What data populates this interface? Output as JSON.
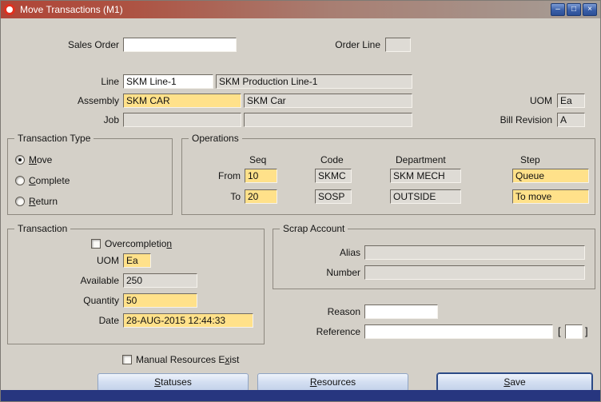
{
  "colors": {
    "titlebar_red": "#b04537",
    "canvas_gray": "#d4d0c8",
    "required_field_yellow": "#ffe18a",
    "readonly_field_gray": "#dedbd5",
    "button_face_blue": "#d5e0f2",
    "bottom_bar_navy": "#27367f"
  },
  "window": {
    "title": "Move Transactions (M1)",
    "minimize_glyph": "–",
    "maximize_glyph": "□",
    "close_glyph": "×"
  },
  "fields": {
    "sales_order": {
      "label": "Sales Order",
      "value": ""
    },
    "order_line": {
      "label": "Order Line",
      "value": ""
    },
    "line": {
      "label": "Line",
      "value": "SKM Line-1",
      "description": "SKM Production Line-1"
    },
    "assembly": {
      "label": "Assembly",
      "value": "SKM CAR",
      "description": "SKM Car"
    },
    "uom_header": {
      "label": "UOM",
      "value": "Ea"
    },
    "job": {
      "label": "Job",
      "value": "",
      "description": ""
    },
    "bill_revision": {
      "label": "Bill Revision",
      "value": "A"
    }
  },
  "transaction_type": {
    "title": "Transaction Type",
    "move": {
      "pre": "",
      "u": "M",
      "rest": "ove",
      "selected": true
    },
    "complete": {
      "pre": "",
      "u": "C",
      "rest": "omplete",
      "selected": false
    },
    "return": {
      "pre": "",
      "u": "R",
      "rest": "eturn",
      "selected": false
    }
  },
  "operations": {
    "title": "Operations",
    "headers": {
      "seq": "Seq",
      "code": "Code",
      "department": "Department",
      "step": "Step"
    },
    "from": {
      "label": "From",
      "seq": "10",
      "code": "SKMC",
      "department": "SKM MECH",
      "step": "Queue"
    },
    "to": {
      "label": "To",
      "seq": "20",
      "code": "SOSP",
      "department": "OUTSIDE",
      "step": "To move"
    }
  },
  "transaction": {
    "title": "Transaction",
    "overcompletion": {
      "pre": "Overcompletio",
      "u": "n",
      "rest": "",
      "checked": false
    },
    "uom": {
      "label": "UOM",
      "value": "Ea"
    },
    "available": {
      "label": "Available",
      "value": "250"
    },
    "quantity": {
      "label": "Quantity",
      "value": "50"
    },
    "date": {
      "label": "Date",
      "value": "28-AUG-2015 12:44:33"
    }
  },
  "scrap_account": {
    "title": "Scrap Account",
    "alias": {
      "label": "Alias",
      "value": ""
    },
    "number": {
      "label": "Number",
      "value": ""
    }
  },
  "reason": {
    "label": "Reason",
    "value": ""
  },
  "reference": {
    "label": "Reference",
    "value": "",
    "bracket_open": "[",
    "bracket_close": "]"
  },
  "manual_resources_exist": {
    "pre": "Manual Resources E",
    "u": "x",
    "rest": "ist",
    "checked": false
  },
  "buttons": {
    "statuses": {
      "pre": "",
      "u": "S",
      "rest": "tatuses"
    },
    "resources": {
      "pre": "",
      "u": "R",
      "rest": "esources"
    },
    "save": {
      "pre": "",
      "u": "S",
      "rest": "ave"
    }
  }
}
